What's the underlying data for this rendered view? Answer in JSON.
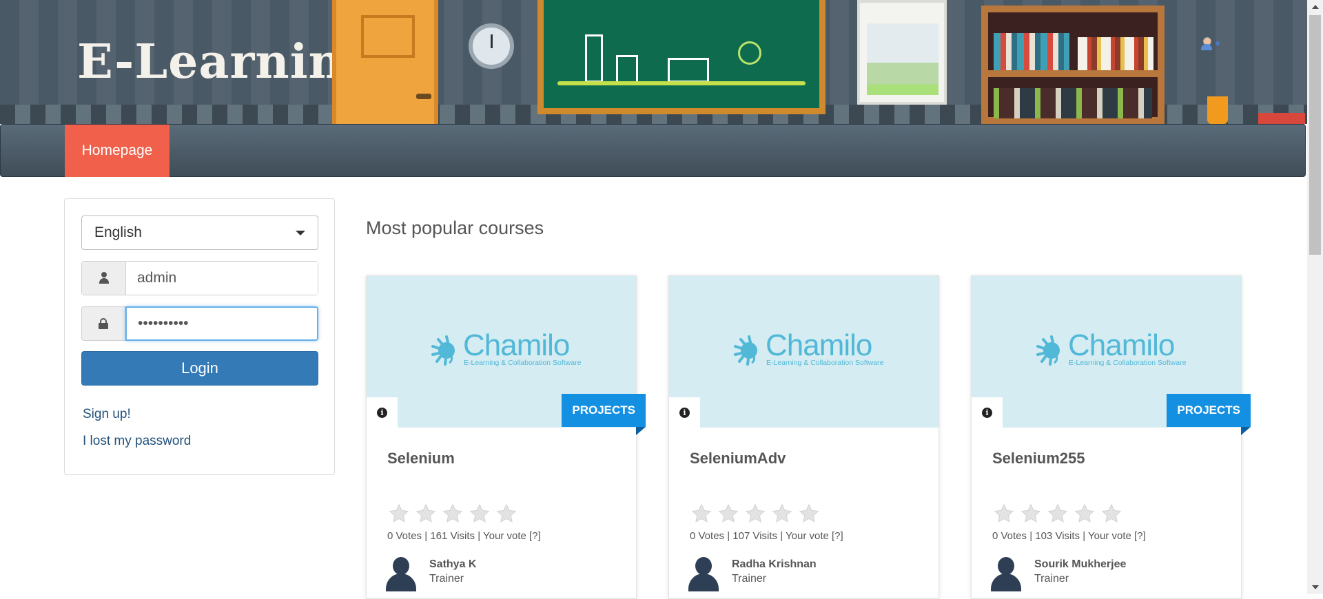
{
  "header": {
    "logo_text": "E-Learning"
  },
  "nav": {
    "items": [
      {
        "label": "Homepage",
        "active": true
      }
    ]
  },
  "login": {
    "language": "English",
    "username": "admin",
    "password": "••••••••••",
    "login_label": "Login",
    "signup_label": "Sign up!",
    "lost_password_label": "I lost my password"
  },
  "courses": {
    "title": "Most popular courses",
    "logo_word": "Chamilo",
    "logo_tagline": "E-Learning & Collaboration Software",
    "items": [
      {
        "title": "Selenium",
        "category": "PROJECTS",
        "votes": "0 Votes",
        "visits": "161 Visits",
        "your_vote": "Your vote [?]",
        "teacher": "Sathya K",
        "role": "Trainer",
        "rating_stars": 0
      },
      {
        "title": "SeleniumAdv",
        "category": "",
        "votes": "0 Votes",
        "visits": "107 Visits",
        "your_vote": "Your vote [?]",
        "teacher": "Radha Krishnan",
        "role": "Trainer",
        "rating_stars": 0
      },
      {
        "title": "Selenium255",
        "category": "PROJECTS",
        "votes": "0 Votes",
        "visits": "103 Visits",
        "your_vote": "Your vote [?]",
        "teacher": "Sourik Mukherjee",
        "role": "Trainer",
        "rating_stars": 0
      }
    ]
  },
  "colors": {
    "accent_nav": "#f0604b",
    "button_primary": "#337ab7",
    "badge": "#1490e3",
    "link": "#23527c"
  }
}
